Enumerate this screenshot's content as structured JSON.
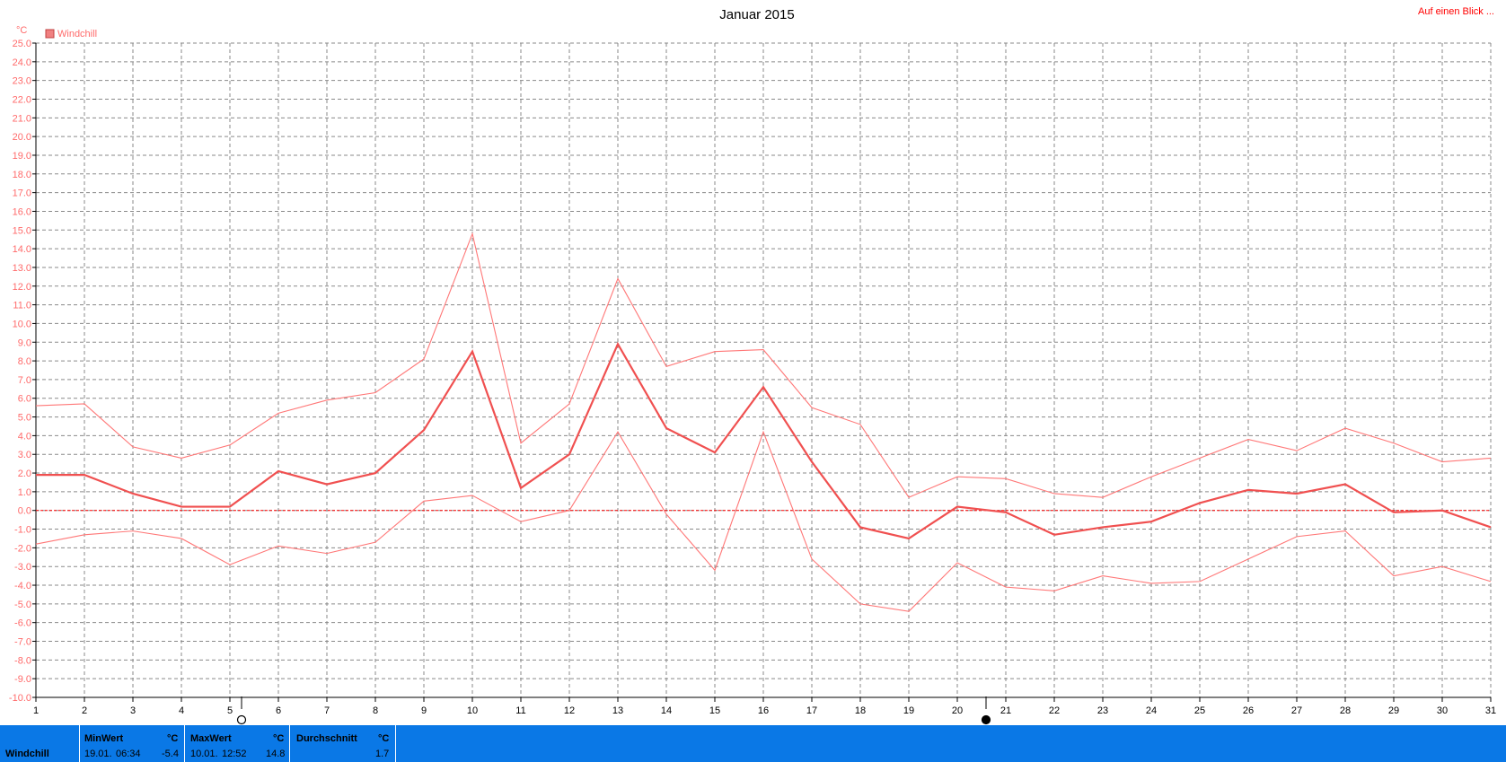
{
  "header": {
    "title": "Januar 2015",
    "link_label": "Auf einen Blick ..."
  },
  "legend": {
    "label": "Windchill",
    "color": "#f08080"
  },
  "axis": {
    "unit": "°C"
  },
  "chart_data": {
    "type": "line",
    "title": "Januar 2015",
    "ylabel": "°C",
    "ylim": [
      -10,
      25
    ],
    "ystep": 1,
    "xlim": [
      1,
      31
    ],
    "x": [
      1,
      2,
      3,
      4,
      5,
      6,
      7,
      8,
      9,
      10,
      11,
      12,
      13,
      14,
      15,
      16,
      17,
      18,
      19,
      20,
      21,
      22,
      23,
      24,
      25,
      26,
      27,
      28,
      29,
      30,
      31
    ],
    "grid": true,
    "zero_line": true,
    "series": [
      {
        "name": "Windchill",
        "role": "max",
        "color": "#ff7777",
        "values": [
          5.6,
          5.7,
          3.4,
          2.8,
          3.5,
          5.2,
          5.9,
          6.3,
          8.1,
          14.8,
          3.6,
          5.7,
          12.4,
          7.7,
          8.5,
          8.6,
          5.5,
          4.6,
          0.7,
          1.8,
          1.7,
          0.9,
          0.7,
          1.8,
          2.8,
          3.8,
          3.2,
          4.4,
          3.6,
          2.6,
          2.8
        ]
      },
      {
        "name": "Windchill",
        "role": "avg",
        "color": "#f05050",
        "values": [
          1.9,
          1.9,
          0.9,
          0.2,
          0.2,
          2.1,
          1.4,
          2.0,
          4.3,
          8.5,
          1.2,
          3.0,
          8.9,
          4.4,
          3.1,
          6.6,
          2.6,
          -0.9,
          -1.5,
          0.2,
          -0.1,
          -1.3,
          -0.9,
          -0.6,
          0.4,
          1.1,
          0.9,
          1.4,
          -0.1,
          0.0,
          -0.9
        ]
      },
      {
        "name": "Windchill",
        "role": "min",
        "color": "#ff7777",
        "values": [
          -1.8,
          -1.3,
          -1.1,
          -1.5,
          -2.9,
          -1.9,
          -2.3,
          -1.7,
          0.5,
          0.8,
          -0.6,
          0.0,
          4.2,
          -0.2,
          -3.2,
          4.2,
          -2.6,
          -5.0,
          -5.4,
          -2.8,
          -4.1,
          -4.3,
          -3.5,
          -3.9,
          -3.8,
          -2.6,
          -1.4,
          -1.1,
          -3.5,
          -3.0,
          -3.8
        ]
      }
    ]
  },
  "stats": {
    "row_label": "Windchill",
    "min": {
      "label": "MinWert",
      "unit": "°C",
      "date": "19.01.",
      "time": "06:34",
      "value": "-5.4"
    },
    "max": {
      "label": "MaxWert",
      "unit": "°C",
      "date": "10.01.",
      "time": "12:52",
      "value": "14.8"
    },
    "avg": {
      "label": "Durchschnitt",
      "unit": "°C",
      "value": "1.7"
    }
  }
}
